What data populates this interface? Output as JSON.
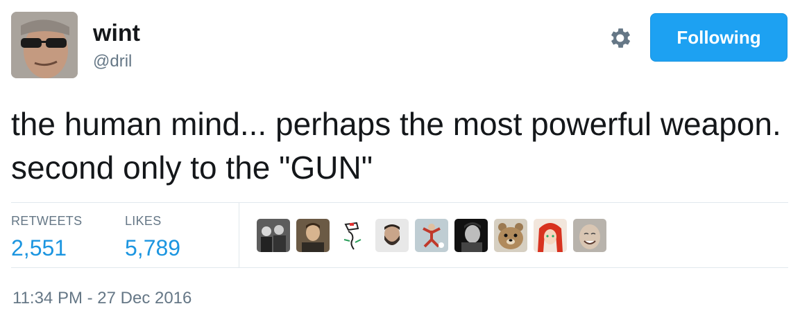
{
  "user": {
    "name": "wint",
    "handle": "@dril",
    "avatar_icon": "profile-photo-man-sunglasses"
  },
  "actions": {
    "settings_icon": "gear-icon",
    "follow_label": "Following",
    "accent_color": "#1da1f2"
  },
  "tweet": {
    "text": "the human mind... perhaps the most powerful weapon. second only to the \"GUN\""
  },
  "stats": {
    "retweets_label": "RETWEETS",
    "retweets_count": "2,551",
    "likes_label": "LIKES",
    "likes_count": "5,789"
  },
  "likers": [
    {
      "icon": "avatar-group-photo"
    },
    {
      "icon": "avatar-man-portrait"
    },
    {
      "icon": "avatar-drawing"
    },
    {
      "icon": "avatar-bearded-man"
    },
    {
      "icon": "avatar-jumping-figure"
    },
    {
      "icon": "avatar-bw-portrait"
    },
    {
      "icon": "avatar-cartoon-bear"
    },
    {
      "icon": "avatar-red-haired-anime"
    },
    {
      "icon": "avatar-smiling-face"
    }
  ],
  "timestamp": "11:34 PM - 27 Dec 2016"
}
